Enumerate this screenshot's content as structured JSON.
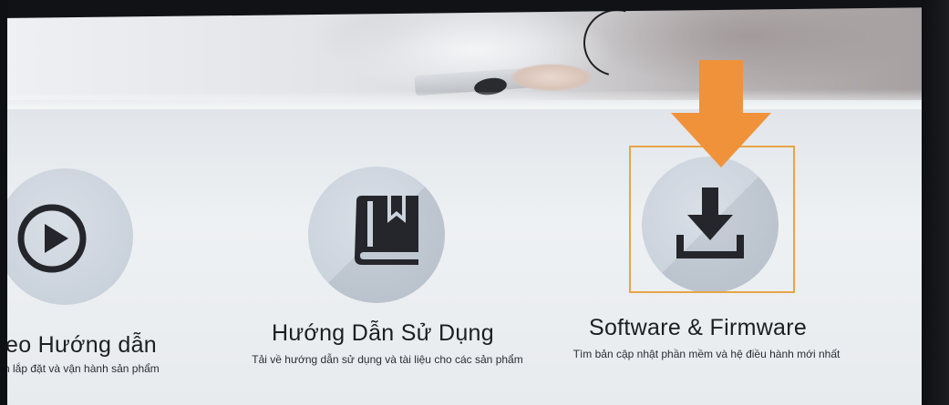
{
  "tiles": [
    {
      "id": "video",
      "title": "eo Hướng dẫn",
      "description": "n lắp đặt và vận hành sản phẩm",
      "icon": "play-circle-icon"
    },
    {
      "id": "manual",
      "title": "Hướng Dẫn Sử Dụng",
      "description": "Tải về hướng dẫn sử dụng và tài liệu cho các sản phẩm",
      "icon": "book-icon"
    },
    {
      "id": "software",
      "title": "Software & Firmware",
      "description": "Tìm bản cập nhật phần mềm và hệ điều hành mới nhất",
      "icon": "download-icon"
    }
  ],
  "annotation": {
    "arrow_color": "#f0923a",
    "highlight_color": "#e7a548",
    "arrow_icon": "orange-down-arrow-icon"
  },
  "colors": {
    "tile_circle": "#cbd3dc",
    "icon_dark": "#24262b",
    "text": "#1c1e22"
  }
}
